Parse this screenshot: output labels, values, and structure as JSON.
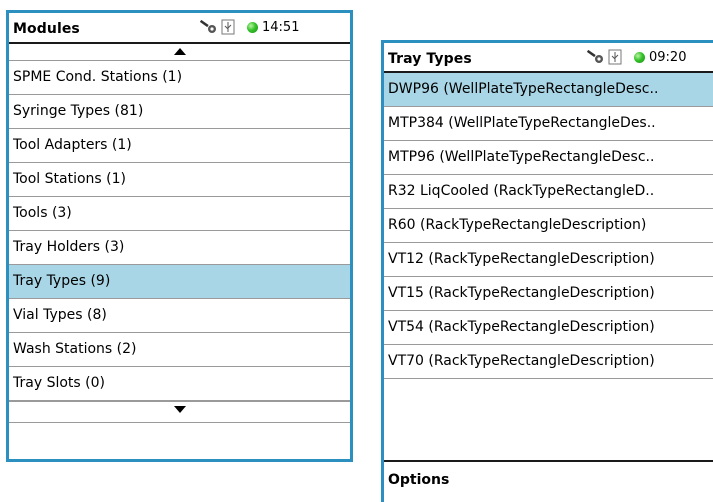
{
  "left_panel": {
    "title": "Modules",
    "time": "14:51",
    "items": [
      "SPME Cond. Stations (1)",
      "Syringe Types (81)",
      "Tool Adapters (1)",
      "Tool Stations (1)",
      "Tools (3)",
      "Tray Holders (3)",
      "Tray Types (9)",
      "Vial Types (8)",
      "Wash Stations (2)",
      "Tray Slots (0)"
    ],
    "selected_index": 6
  },
  "right_panel": {
    "title": "Tray Types",
    "time": "09:20",
    "items": [
      "DWP96 (WellPlateTypeRectangleDesc..",
      "MTP384 (WellPlateTypeRectangleDes..",
      "MTP96 (WellPlateTypeRectangleDesc..",
      "R32 LiqCooled (RackTypeRectangleD..",
      "R60 (RackTypeRectangleDescription)",
      "VT12 (RackTypeRectangleDescription)",
      "VT15 (RackTypeRectangleDescription)",
      "VT54 (RackTypeRectangleDescription)",
      "VT70 (RackTypeRectangleDescription)"
    ],
    "selected_index": 0,
    "options_label": "Options"
  },
  "colors": {
    "panel_border": "#2b8fc0",
    "selected_bg": "#a9d6e6",
    "led_green": "#35c22a"
  },
  "icons": [
    "key-icon",
    "usb-icon",
    "status-led-icon",
    "scroll-up-icon",
    "scroll-down-icon"
  ]
}
